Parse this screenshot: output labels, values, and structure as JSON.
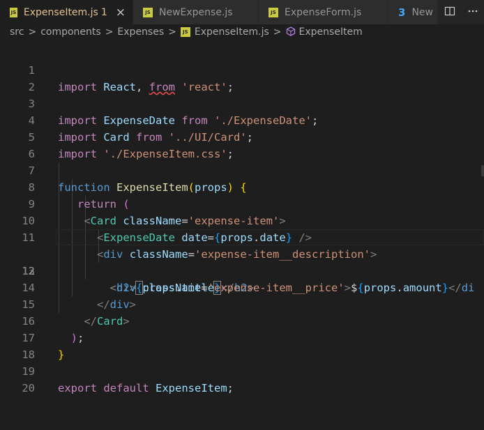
{
  "tabs": [
    {
      "label": "ExpenseItem.js",
      "icon": "js-icon",
      "icon_text": "JS",
      "badge": "1",
      "active": true
    },
    {
      "label": "NewExpense.js",
      "icon": "js-icon",
      "icon_text": "JS",
      "active": false
    },
    {
      "label": "ExpenseForm.js",
      "icon": "js-icon",
      "icon_text": "JS",
      "active": false
    },
    {
      "label": "New",
      "icon": "css-icon",
      "icon_text": "3",
      "active": false
    }
  ],
  "tab_close_glyph": "×",
  "breadcrumb": [
    "src",
    "components",
    "Expenses",
    "ExpenseItem.js",
    "ExpenseItem"
  ],
  "breadcrumb_sep": ">",
  "colors": {
    "accent_tab": "#e2c08d",
    "background": "#1e1e1e",
    "keyword": "#569cd6",
    "string": "#ce9178",
    "error_squiggle": "#f14c4c"
  },
  "current_line": 12,
  "lines": [
    {
      "num": "1",
      "text": "import React, from 'react';"
    },
    {
      "num": "2",
      "text": ""
    },
    {
      "num": "3",
      "text": "import ExpenseDate from './ExpenseDate';"
    },
    {
      "num": "4",
      "text": "import Card from '../UI/Card';"
    },
    {
      "num": "5",
      "text": "import './ExpenseItem.css';"
    },
    {
      "num": "6",
      "text": ""
    },
    {
      "num": "7",
      "text": "function ExpenseItem(props) {"
    },
    {
      "num": "8",
      "text": "  return ("
    },
    {
      "num": "9",
      "text": "    <Card className='expense-item'>"
    },
    {
      "num": "10",
      "text": "      <ExpenseDate date={props.date} />"
    },
    {
      "num": "11",
      "text": "      <div className='expense-item__description'>"
    },
    {
      "num": "12",
      "text": "        <h2>{props.title}</h2>"
    },
    {
      "num": "13",
      "text": "        <div className='expense-item__price'>${props.amount}</di"
    },
    {
      "num": "14",
      "text": "      </div>"
    },
    {
      "num": "15",
      "text": "    </Card>"
    },
    {
      "num": "16",
      "text": "  );"
    },
    {
      "num": "17",
      "text": "}"
    },
    {
      "num": "18",
      "text": ""
    },
    {
      "num": "19",
      "text": "export default ExpenseItem;"
    },
    {
      "num": "20",
      "text": ""
    }
  ]
}
